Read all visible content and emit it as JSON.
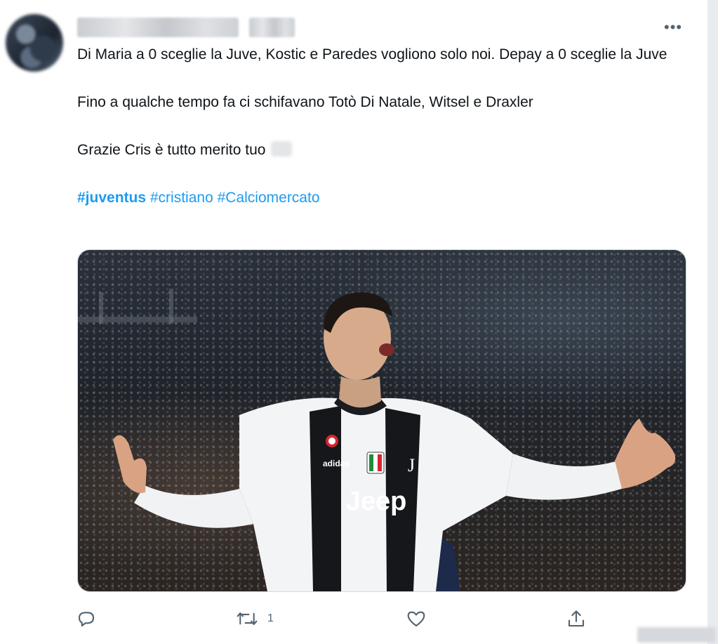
{
  "tweet": {
    "paragraphs": [
      "Di Maria a 0 sceglie la Juve, Kostic e Paredes vogliono solo noi. Depay a 0 sceglie la Juve",
      "Fino a qualche tempo fa ci schifavano Totò Di Natale, Witsel e Draxler",
      "Grazie Cris è tutto merito tuo"
    ],
    "hashtags": [
      "#juventus",
      "#cristiano",
      "#Calciomercato"
    ],
    "more_label": "•••",
    "media": {
      "shirt_sponsor": "Jeep",
      "shirt_brand": "adidas"
    }
  },
  "actions": {
    "reply_icon": "reply-icon",
    "retweet_icon": "retweet-icon",
    "retweet_count": "1",
    "like_icon": "heart-icon",
    "share_icon": "share-icon"
  },
  "colors": {
    "accent": "#1d9bf0",
    "icon": "#536471",
    "text": "#0f1419"
  }
}
